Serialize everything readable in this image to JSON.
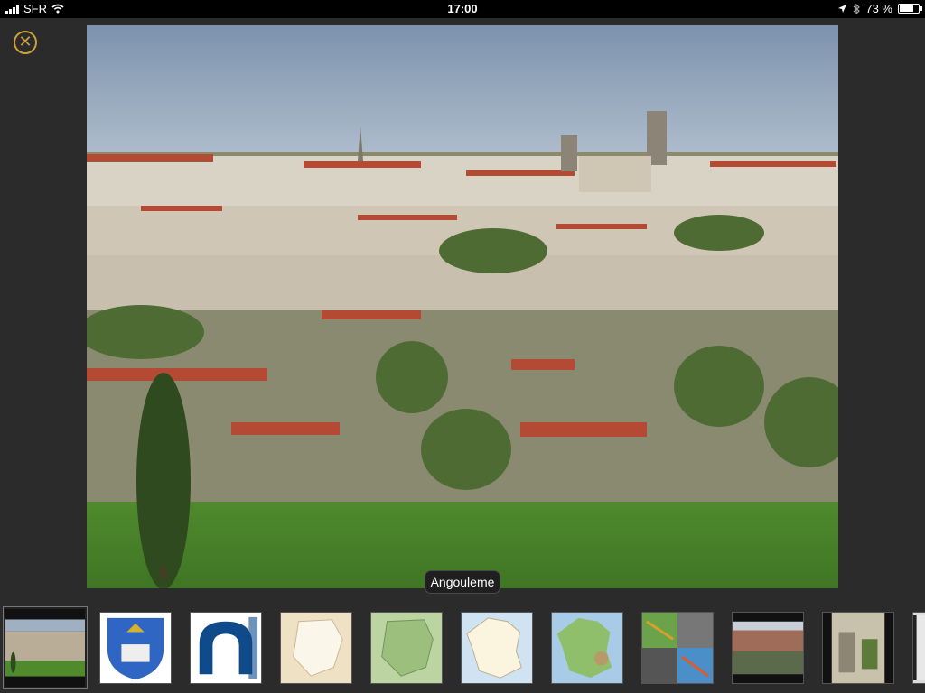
{
  "status_bar": {
    "carrier": "SFR",
    "time": "17:00",
    "battery_percent": "73 %",
    "battery_level": 0.73,
    "icons": [
      "signal-icon",
      "wifi-icon",
      "location-icon",
      "bluetooth-icon",
      "battery-icon"
    ]
  },
  "viewer": {
    "close_icon": "close-circle-icon",
    "caption": "Angouleme",
    "thumbnails": [
      {
        "name": "photo-city",
        "selected": true
      },
      {
        "name": "coat-of-arms",
        "selected": false
      },
      {
        "name": "logo",
        "selected": false
      },
      {
        "name": "map-beige",
        "selected": false
      },
      {
        "name": "map-green",
        "selected": false
      },
      {
        "name": "map-france-light",
        "selected": false
      },
      {
        "name": "map-france-relief",
        "selected": false
      },
      {
        "name": "terrain-tiles",
        "selected": false
      },
      {
        "name": "photo-building",
        "selected": false
      },
      {
        "name": "photo-tower",
        "selected": false
      }
    ]
  },
  "colors": {
    "accent": "#c7a13b",
    "background": "#2b2b2b"
  }
}
